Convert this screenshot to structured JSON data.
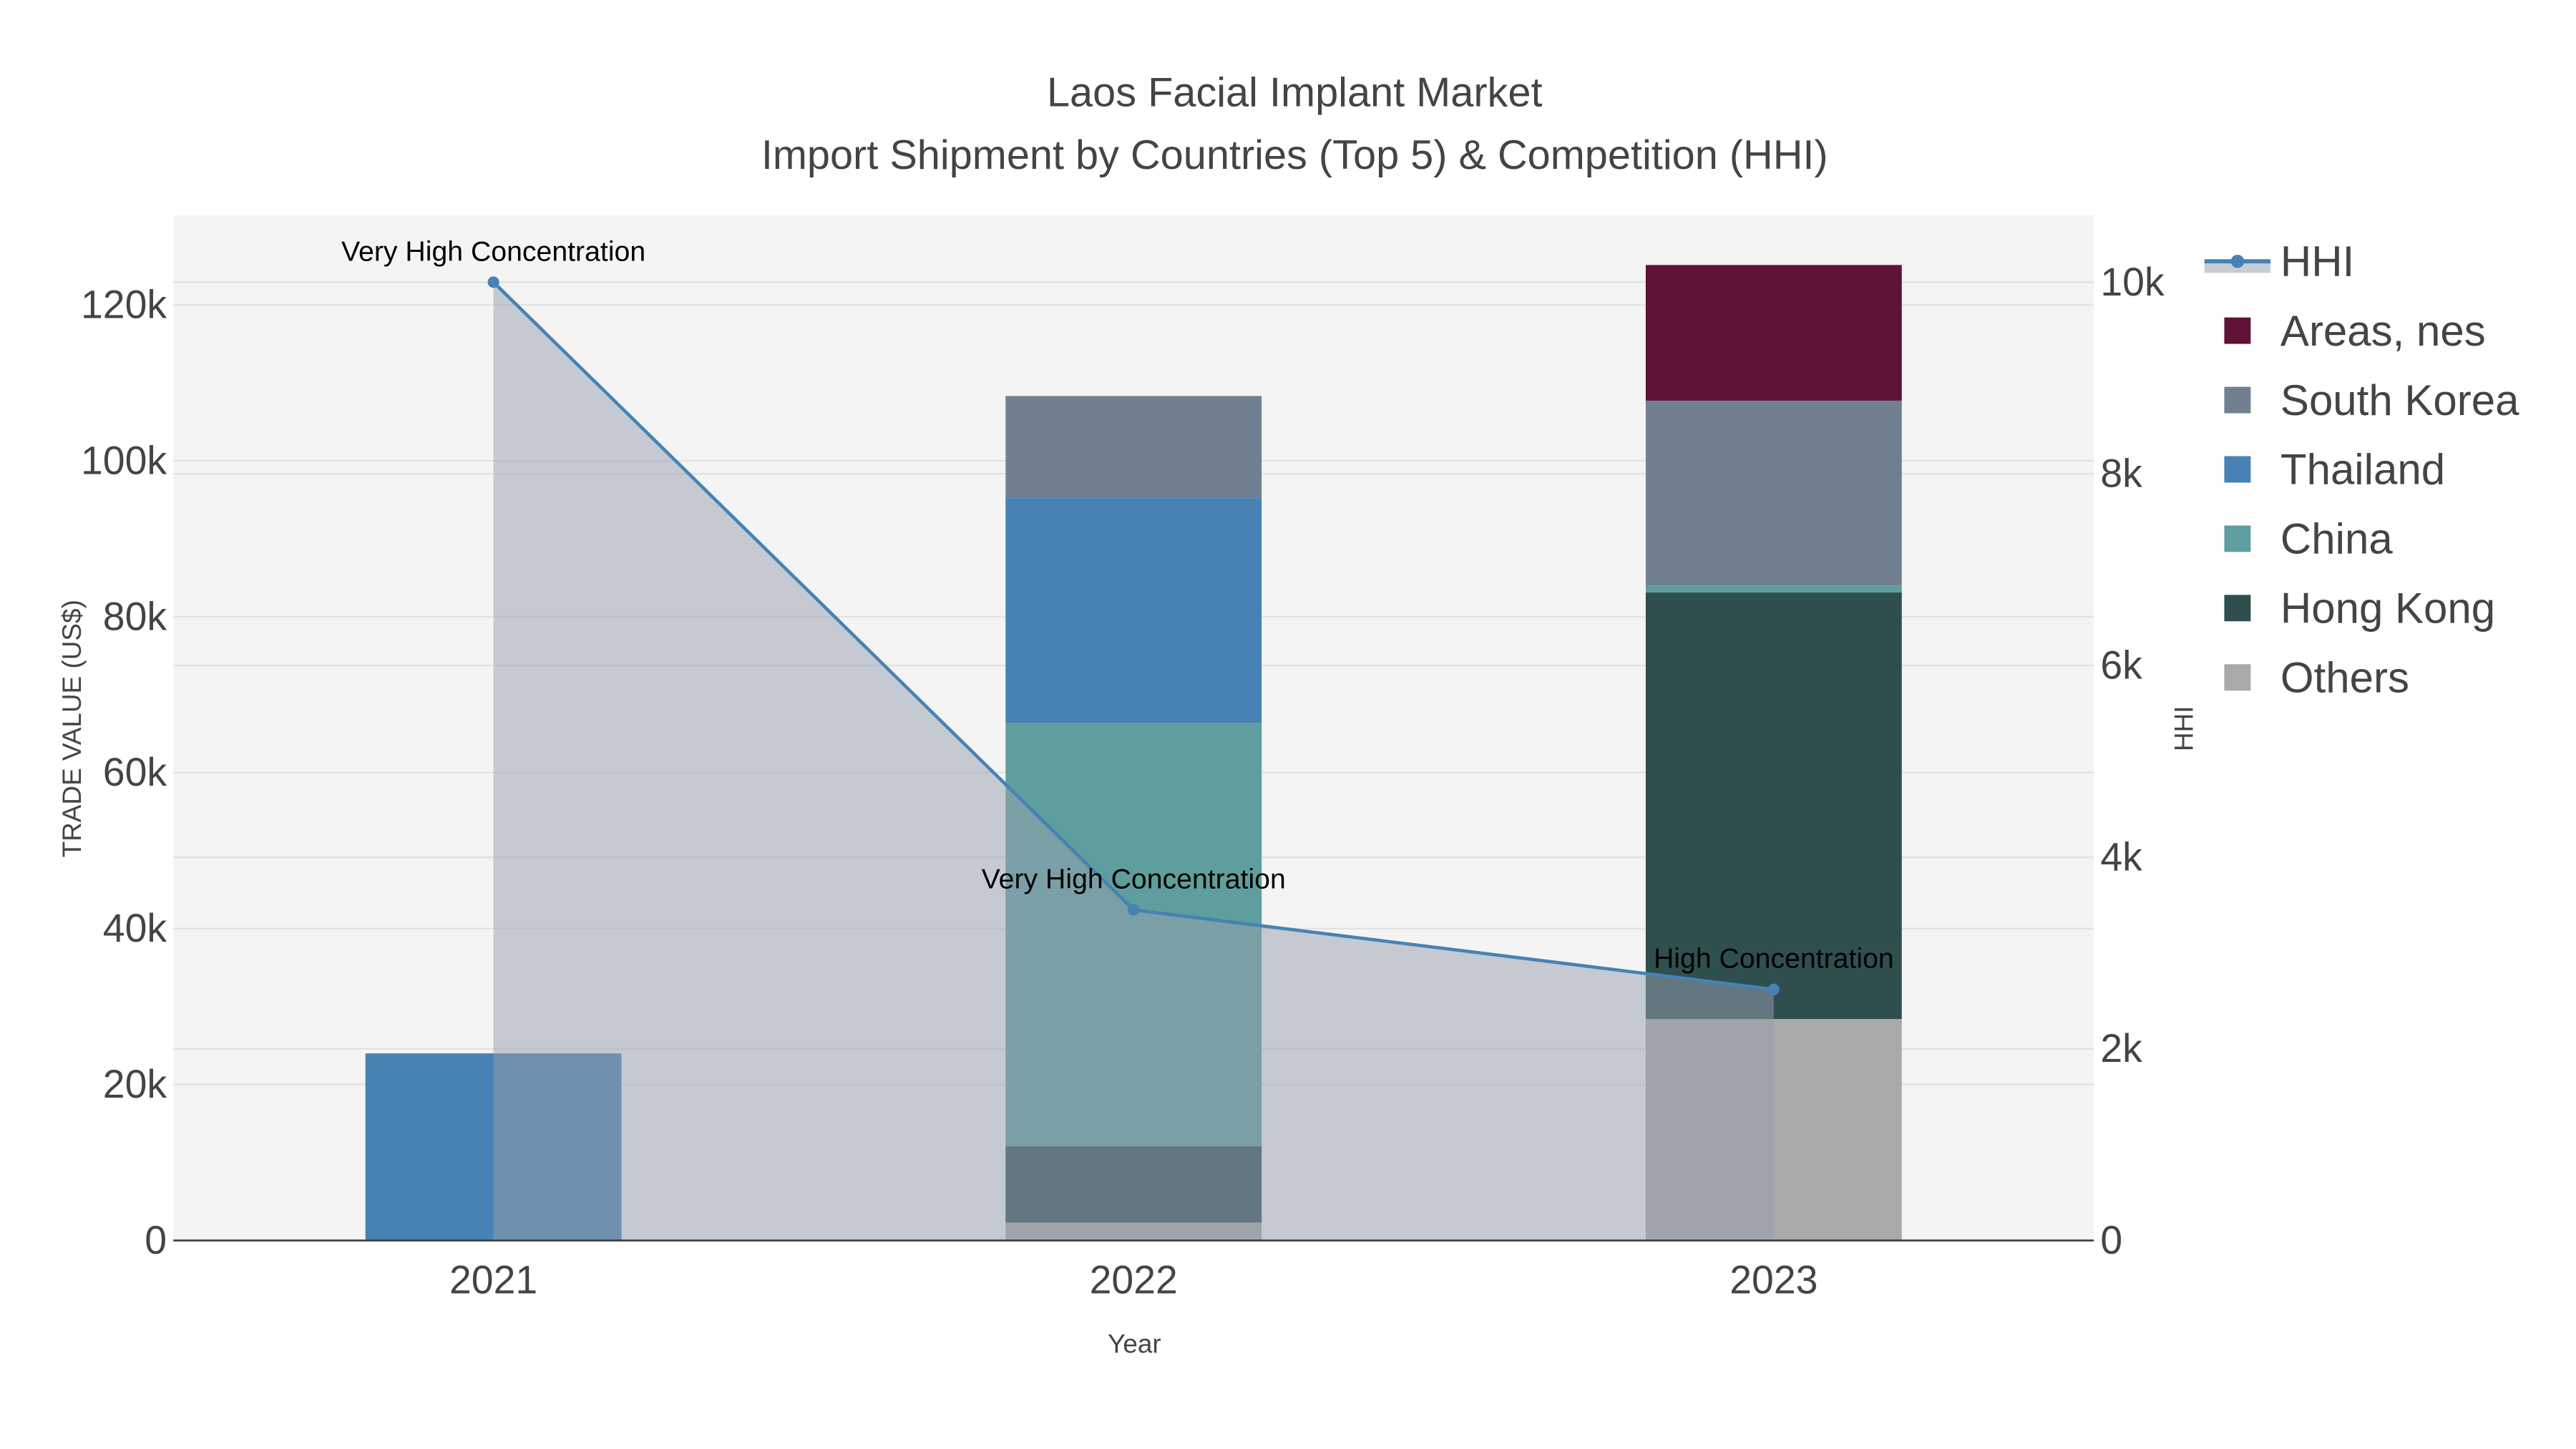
{
  "chart_data": {
    "type": "bar",
    "title": "Laos Facial Implant Market",
    "subtitle": "Import Shipment by Countries (Top 5) & Competition (HHI)",
    "xlabel": "Year",
    "ylabel": "TRADE VALUE (US$)",
    "y2label": "HHI",
    "barmode": "stack",
    "categories": [
      "2021",
      "2022",
      "2023"
    ],
    "ylim": [
      0,
      131500
    ],
    "y2lim": [
      0,
      10700
    ],
    "yticks": [
      0,
      20000,
      40000,
      60000,
      80000,
      100000,
      120000
    ],
    "ytick_labels": [
      "0",
      "20k",
      "40k",
      "60k",
      "80k",
      "100k",
      "120k"
    ],
    "y2ticks": [
      0,
      2000,
      4000,
      6000,
      8000,
      10000
    ],
    "y2tick_labels": [
      "0",
      "2k",
      "4k",
      "6k",
      "8k",
      "10k"
    ],
    "grid": true,
    "legend_position": "right",
    "series": [
      {
        "name": "Others",
        "color": "#a9a9a9",
        "values": [
          0,
          2300,
          28400
        ]
      },
      {
        "name": "Hong Kong",
        "color": "#2f4f4f",
        "values": [
          0,
          9800,
          54700
        ]
      },
      {
        "name": "China",
        "color": "#5f9e9e",
        "values": [
          0,
          54300,
          900
        ]
      },
      {
        "name": "Thailand",
        "color": "#4682b4",
        "values": [
          24000,
          28800,
          0
        ]
      },
      {
        "name": "South Korea",
        "color": "#708090",
        "values": [
          0,
          13100,
          23700
        ]
      },
      {
        "name": "Areas, nes",
        "color": "#5f1336",
        "values": [
          0,
          0,
          17400
        ]
      }
    ],
    "line": {
      "name": "HHI",
      "color": "#4682b4",
      "fill": "#c8cdd4",
      "values": [
        10000,
        3450,
        2620
      ],
      "annotations": [
        "Very High Concentration",
        "Very High Concentration",
        "High Concentration"
      ]
    },
    "legend_order": [
      "HHI",
      "Areas, nes",
      "South Korea",
      "Thailand",
      "China",
      "Hong Kong",
      "Others"
    ]
  }
}
